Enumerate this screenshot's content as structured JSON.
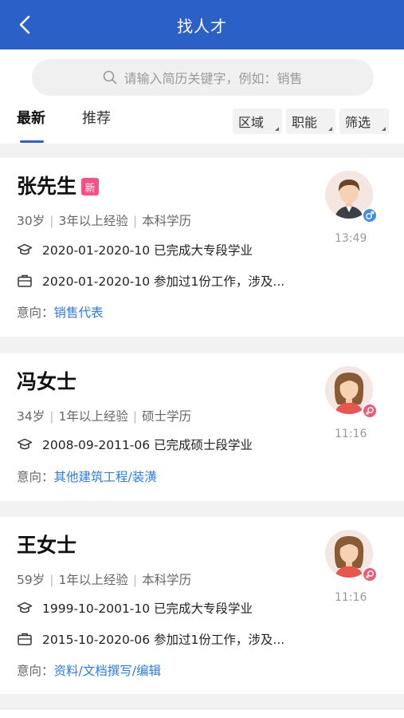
{
  "header": {
    "title": "找人才"
  },
  "search": {
    "placeholder": "请输入简历关键字，例如：销售"
  },
  "tabs": [
    {
      "label": "最新",
      "active": true
    },
    {
      "label": "推荐",
      "active": false
    }
  ],
  "filters": [
    {
      "label": "区域"
    },
    {
      "label": "职能"
    },
    {
      "label": "筛选"
    }
  ],
  "intent_label": "意向：",
  "candidates": [
    {
      "name": "张先生",
      "badge": "新",
      "age": "30岁",
      "experience": "3年以上经验",
      "degree": "本科学历",
      "education": "2020-01-2020-10 已完成大专段学业",
      "work": "2020-01-2020-10 参加过1份工作，涉及...",
      "intent": "销售代表",
      "time": "13:49",
      "gender": "male"
    },
    {
      "name": "冯女士",
      "age": "34岁",
      "experience": "1年以上经验",
      "degree": "硕士学历",
      "education": "2008-09-2011-06 已完成硕士段学业",
      "intent": "其他建筑工程/装潢",
      "time": "11:16",
      "gender": "female"
    },
    {
      "name": "王女士",
      "age": "59岁",
      "experience": "1年以上经验",
      "degree": "本科学历",
      "education": "1999-10-2001-10 已完成大专段学业",
      "work": "2015-10-2020-06 参加过1份工作，涉及...",
      "intent": "资料/文档撰写/编辑",
      "time": "11:16",
      "gender": "female"
    }
  ],
  "colors": {
    "primary": "#2b60c9",
    "link": "#2b7be0",
    "badge": "#ff4d88",
    "male": "#3d8ee8",
    "female": "#ee5a7a"
  }
}
